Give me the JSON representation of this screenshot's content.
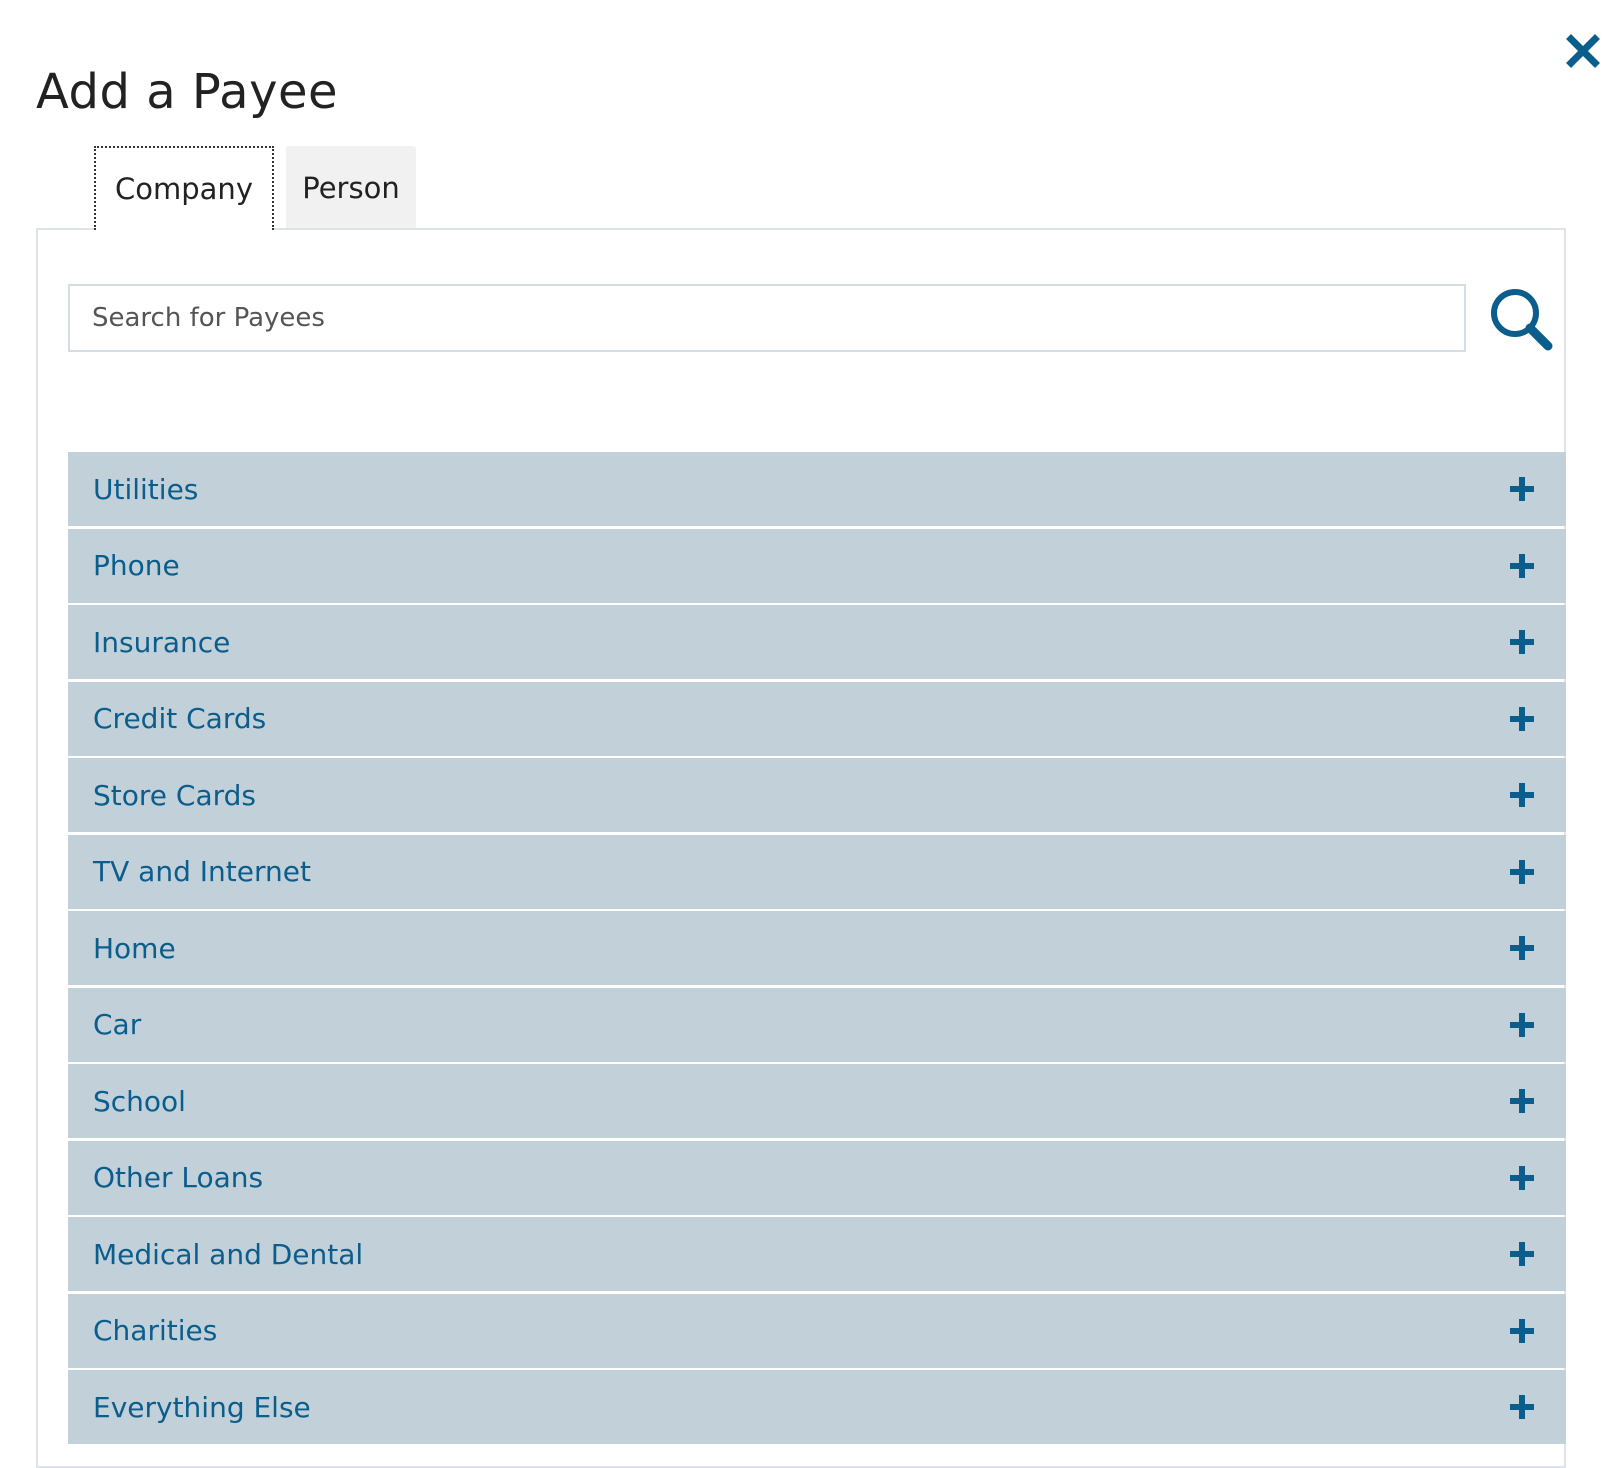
{
  "dialog": {
    "title": "Add a Payee"
  },
  "tabs": [
    {
      "label": "Company",
      "active": true
    },
    {
      "label": "Person",
      "active": false
    }
  ],
  "search": {
    "placeholder": "Search for Payees",
    "value": ""
  },
  "categories": [
    {
      "label": "Utilities"
    },
    {
      "label": "Phone"
    },
    {
      "label": "Insurance"
    },
    {
      "label": "Credit Cards"
    },
    {
      "label": "Store Cards"
    },
    {
      "label": "TV and Internet"
    },
    {
      "label": "Home"
    },
    {
      "label": "Car"
    },
    {
      "label": "School"
    },
    {
      "label": "Other Loans"
    },
    {
      "label": "Medical and Dental"
    },
    {
      "label": "Charities"
    },
    {
      "label": "Everything Else"
    }
  ],
  "icons": {
    "close": "close-icon",
    "search": "search-icon",
    "expand": "plus-icon"
  },
  "colors": {
    "accent": "#0b5d8c",
    "row_background": "#c2d0da",
    "title_text": "#222222"
  }
}
